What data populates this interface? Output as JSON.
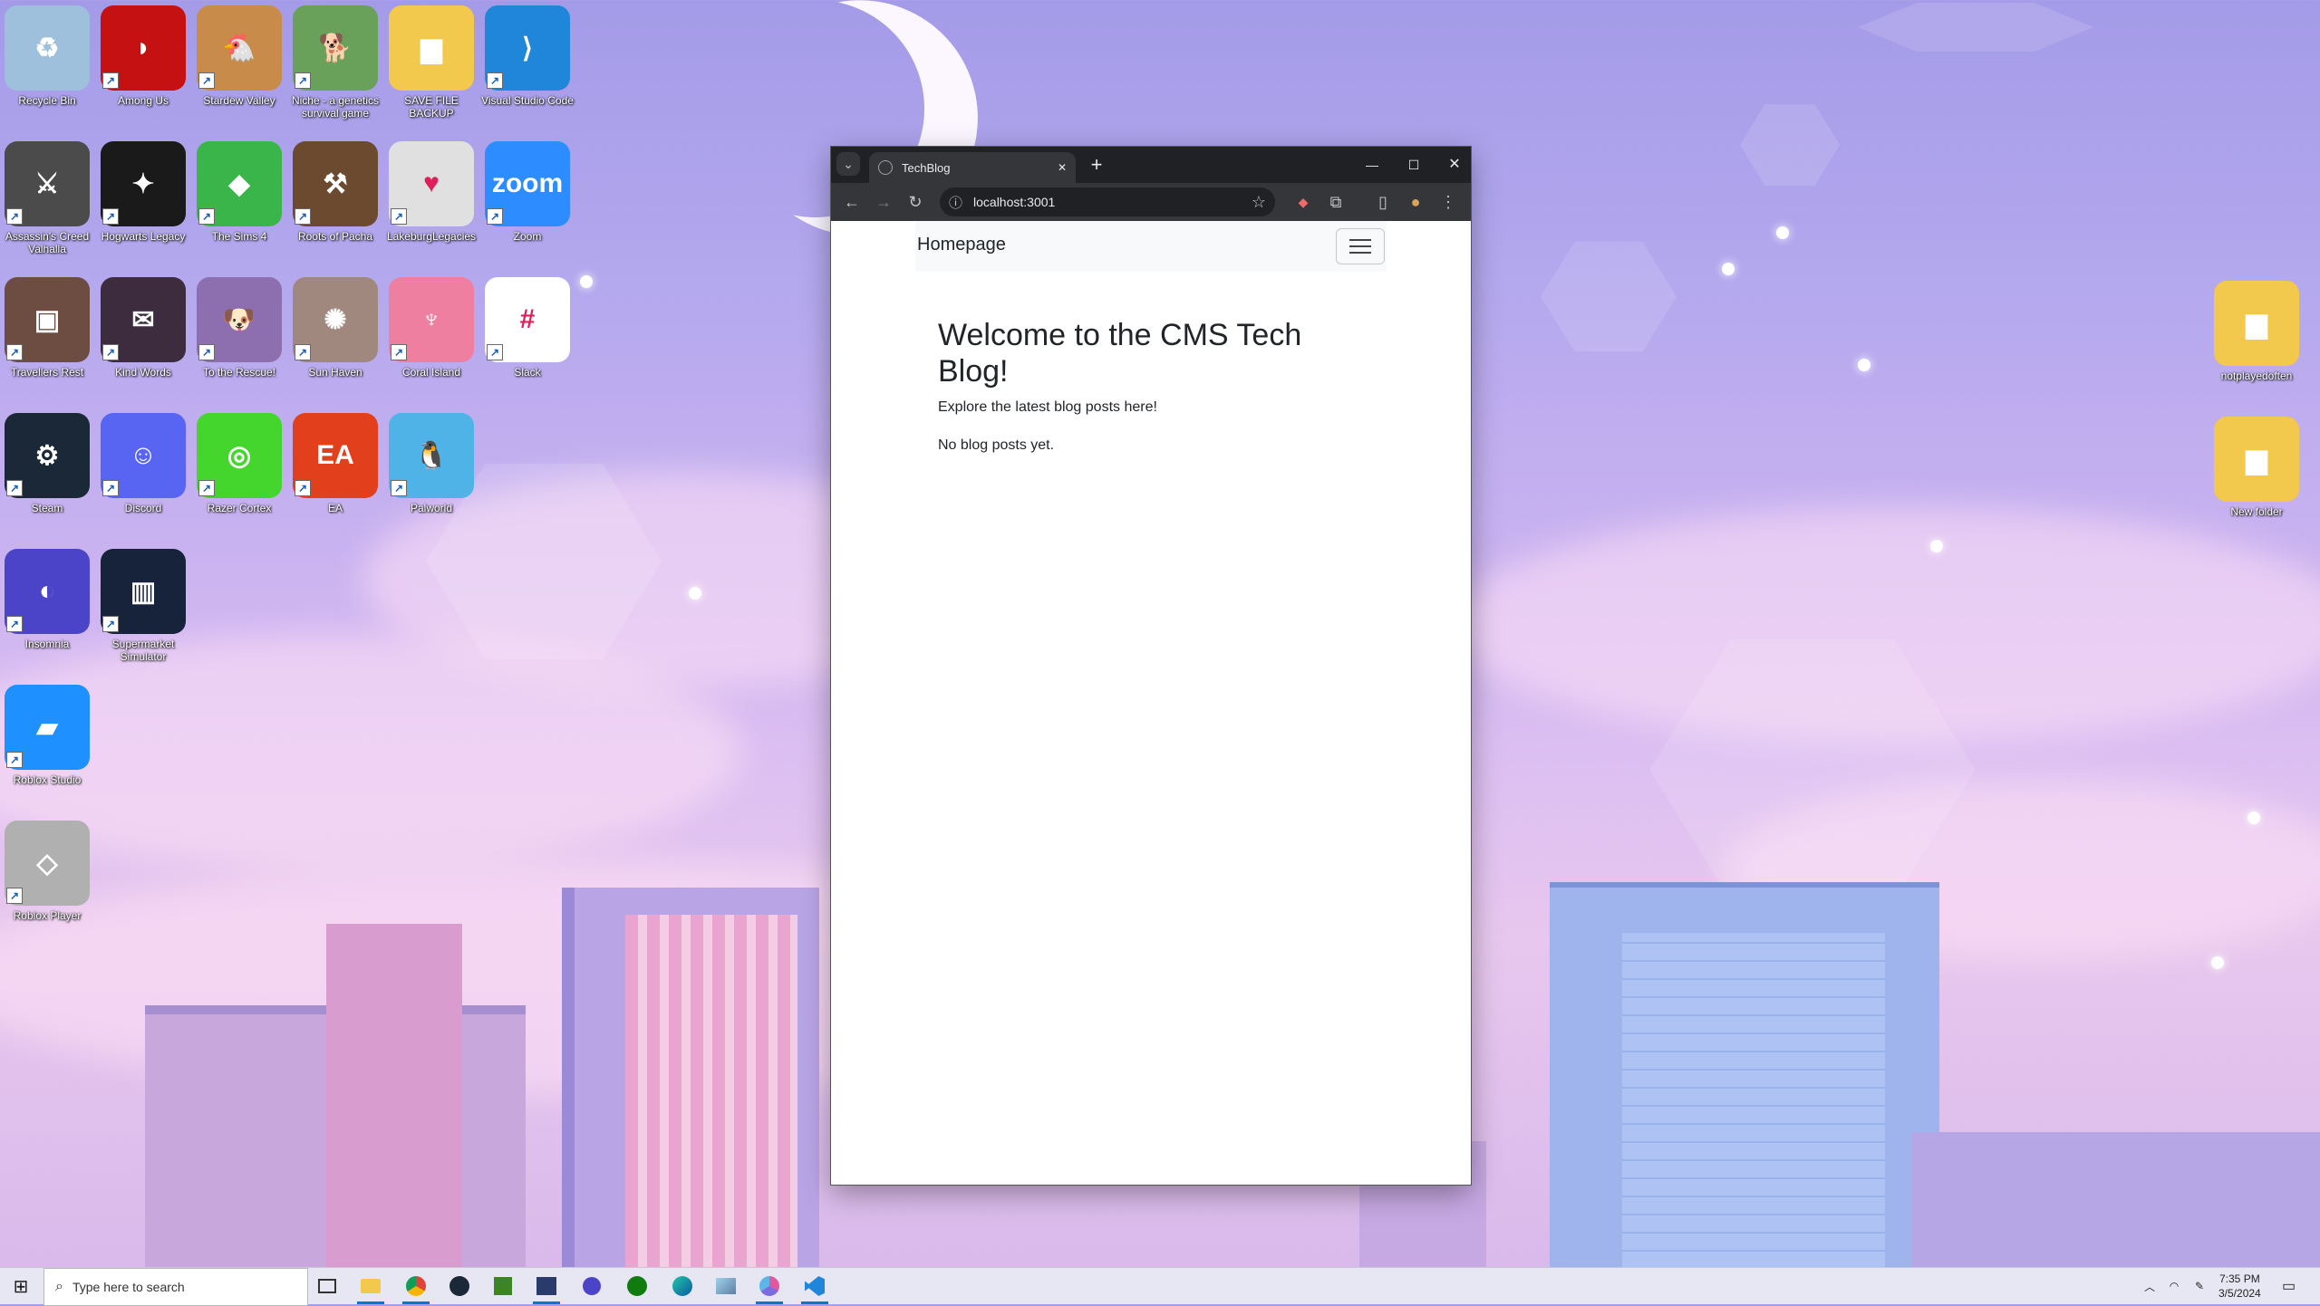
{
  "desktop": {
    "icons": [
      {
        "label": "Recycle Bin",
        "glyph": "♻",
        "color": "#9fc0dd"
      },
      {
        "label": "Among Us",
        "glyph": "◗",
        "color": "#c51111"
      },
      {
        "label": "Stardew Valley",
        "glyph": "🐔",
        "color": "#c98b4a"
      },
      {
        "label": "Niche - a genetics survival game",
        "glyph": "🐕",
        "color": "#6aa15a"
      },
      {
        "label": "SAVE FILE BACKUP",
        "glyph": "▆",
        "color": "#f2c94c"
      },
      {
        "label": "Visual Studio Code",
        "glyph": "⟩",
        "color": "#1f86d9"
      },
      {
        "label": "Assassin's Creed Valhalla",
        "glyph": "⚔",
        "color": "#4b4b4b"
      },
      {
        "label": "Hogwarts Legacy",
        "glyph": "✦",
        "color": "#1a1a1a"
      },
      {
        "label": "The Sims 4",
        "glyph": "◆",
        "color": "#39b54a"
      },
      {
        "label": "Roots of Pacha",
        "glyph": "⚒",
        "color": "#6b4a2f"
      },
      {
        "label": "LakeburgLegacies",
        "glyph": "♥",
        "color": "#e0e0e0"
      },
      {
        "label": "Zoom",
        "glyph": "zoom",
        "color": "#2d8cff"
      },
      {
        "label": "Travellers Rest",
        "glyph": "▣",
        "color": "#6d4c41"
      },
      {
        "label": "Kind Words",
        "glyph": "✉",
        "color": "#3d2c3d"
      },
      {
        "label": "To the Rescue!",
        "glyph": "🐶",
        "color": "#8d6fb0"
      },
      {
        "label": "Sun Haven",
        "glyph": "✺",
        "color": "#a1887f"
      },
      {
        "label": "Coral Island",
        "glyph": "♆",
        "color": "#ef7fa0"
      },
      {
        "label": "Slack",
        "glyph": "#",
        "color": "#ffffff"
      },
      {
        "label": "Steam",
        "glyph": "⚙",
        "color": "#1b2838"
      },
      {
        "label": "Discord",
        "glyph": "☺",
        "color": "#5865f2"
      },
      {
        "label": "Razer Cortex",
        "glyph": "◎",
        "color": "#44d62c"
      },
      {
        "label": "EA",
        "glyph": "EA",
        "color": "#e2401c"
      },
      {
        "label": "Palworld",
        "glyph": "🐧",
        "color": "#4fb3e8"
      },
      {
        "label": "Insomnia",
        "glyph": "◐",
        "color": "#4b44c9"
      },
      {
        "label": "Supermarket Simulator",
        "glyph": "▥",
        "color": "#17233a"
      },
      {
        "label": "Roblox Studio",
        "glyph": "▰",
        "color": "#1e90ff"
      },
      {
        "label": "Roblox Player",
        "glyph": "◇",
        "color": "#b0b0b0"
      },
      {
        "label": "notplayedoften",
        "glyph": "▆",
        "color": "#f2c94c"
      },
      {
        "label": "New folder",
        "glyph": "▆",
        "color": "#f2c94c"
      }
    ]
  },
  "browser": {
    "tab_title": "TechBlog",
    "new_tab_symbol": "+",
    "tab_close_symbol": "✕",
    "url": "localhost:3001",
    "window_controls": {
      "minimize": "—",
      "maximize": "☐",
      "close": "✕"
    },
    "toolbar_glyphs": {
      "back": "←",
      "forward": "→",
      "reload": "↻",
      "site_info": "ⓘ",
      "bookmark": "☆",
      "extension": "◆",
      "puzzle": "⧉",
      "sidepanel": "▯",
      "profile": "●",
      "menu": "⋮",
      "tab_search": "⌄"
    }
  },
  "page": {
    "navbar_brand": "Homepage",
    "heading": "Welcome to the CMS Tech Blog!",
    "subtitle": "Explore the latest blog posts here!",
    "empty_message": "No blog posts yet."
  },
  "taskbar": {
    "search_placeholder": "Type here to search",
    "time": "7:35 PM",
    "date": "3/5/2024",
    "start_glyph": "⊞",
    "apps": [
      "task-view",
      "file-explorer",
      "chrome",
      "steam",
      "minecraft",
      "visual-studio",
      "insomnia",
      "xbox",
      "edge",
      "terminal",
      "chrome-canary",
      "vscode"
    ]
  }
}
